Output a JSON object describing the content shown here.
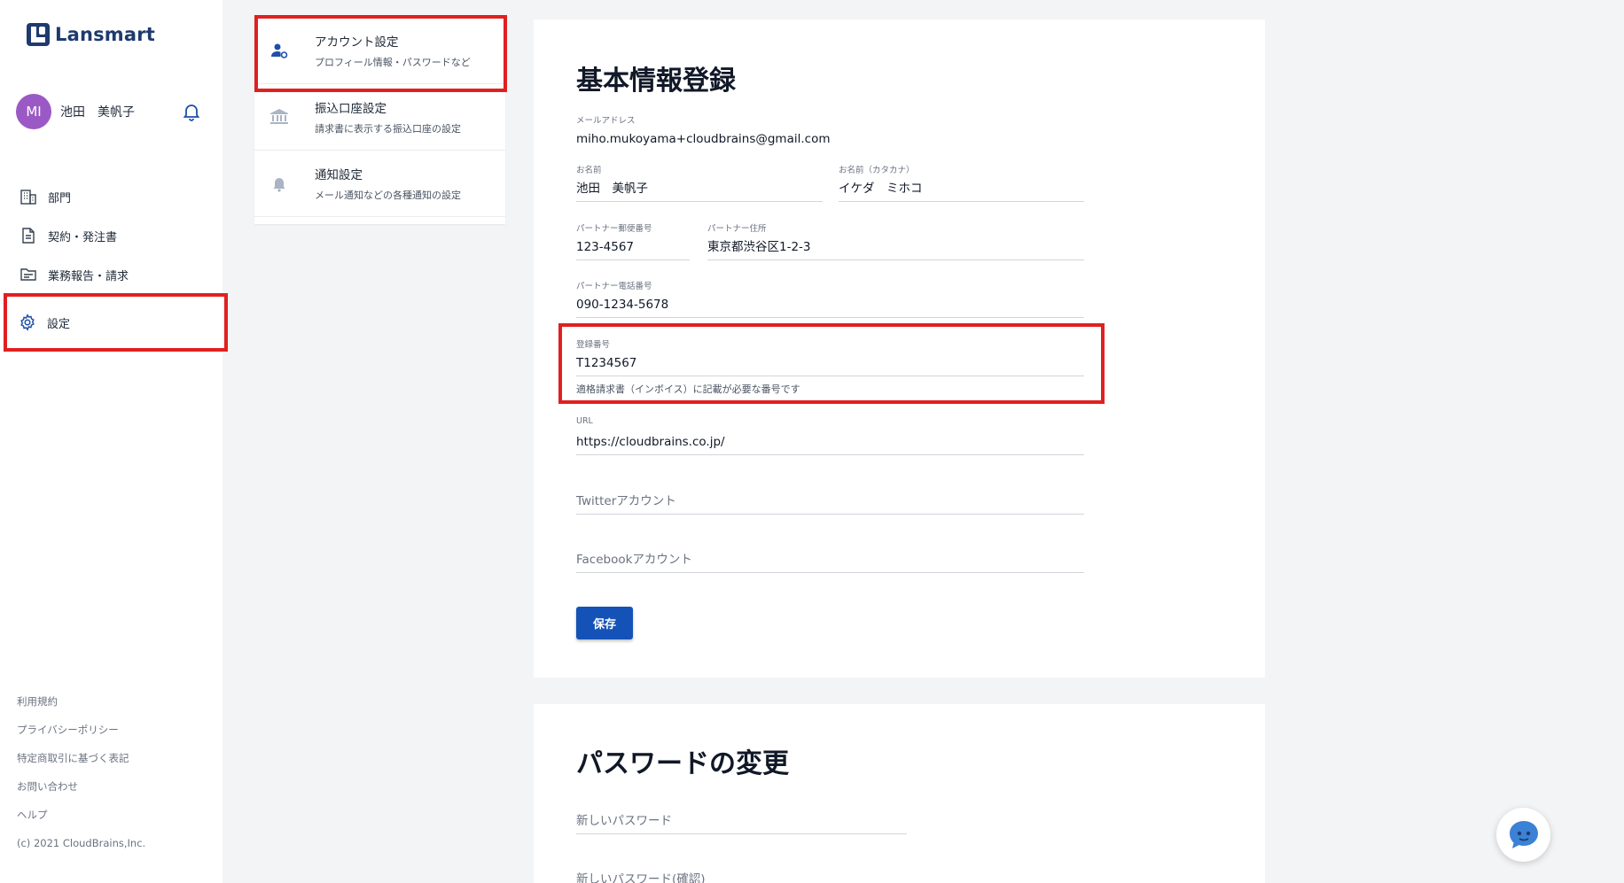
{
  "app": {
    "logo_text": "Lansmart"
  },
  "user": {
    "initials": "MI",
    "name": "池田　美帆子"
  },
  "nav": {
    "items": [
      {
        "label": "部門"
      },
      {
        "label": "契約・発注書"
      },
      {
        "label": "業務報告・請求"
      },
      {
        "label": "設定"
      }
    ]
  },
  "footer": {
    "links": [
      "利用規約",
      "プライバシーポリシー",
      "特定商取引に基づく表記",
      "お問い合わせ",
      "ヘルプ"
    ],
    "copyright": "(c) 2021 CloudBrains,Inc."
  },
  "submenu": {
    "items": [
      {
        "title": "アカウント設定",
        "desc": "プロフィール情報・パスワードなど"
      },
      {
        "title": "振込口座設定",
        "desc": "請求書に表示する振込口座の設定"
      },
      {
        "title": "通知設定",
        "desc": "メール通知などの各種通知の設定"
      }
    ]
  },
  "basic": {
    "title": "基本情報登録",
    "email": {
      "label": "メールアドレス",
      "value": "miho.mukoyama+cloudbrains@gmail.com"
    },
    "name": {
      "label": "お名前",
      "value": "池田　美帆子"
    },
    "kana": {
      "label": "お名前（カタカナ）",
      "value": "イケダ　ミホコ"
    },
    "zip": {
      "label": "パートナー郵便番号",
      "value": "123-4567"
    },
    "address": {
      "label": "パートナー住所",
      "value": "東京都渋谷区1-2-3"
    },
    "phone": {
      "label": "パートナー電話番号",
      "value": "090-1234-5678"
    },
    "reg": {
      "label": "登録番号",
      "value": "T1234567",
      "help": "適格請求書（インボイス）に記載が必要な番号です"
    },
    "url": {
      "label": "URL",
      "value": "https://cloudbrains.co.jp/"
    },
    "twitter": {
      "placeholder": "Twitterアカウント"
    },
    "facebook": {
      "placeholder": "Facebookアカウント"
    },
    "save_label": "保存"
  },
  "password": {
    "title": "パスワードの変更",
    "new_placeholder": "新しいパスワード",
    "confirm_placeholder": "新しいパスワード(確認)"
  },
  "colors": {
    "primary": "#1552b8",
    "highlight": "#e02020",
    "avatar": "#9b59c6"
  }
}
